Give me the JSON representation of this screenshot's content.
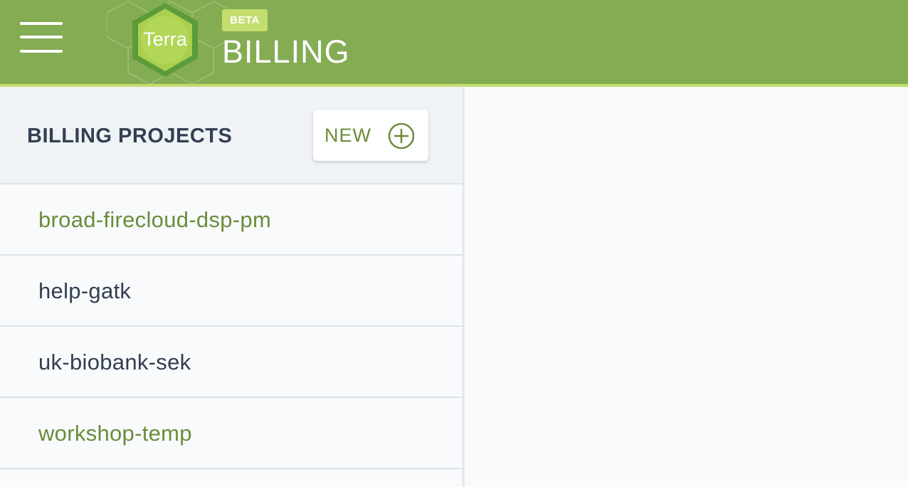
{
  "header": {
    "logo_text": "Terra",
    "beta_badge": "BETA",
    "title": "BILLING",
    "colors": {
      "bar": "#84ac53",
      "accent": "#c3de6f"
    }
  },
  "sidebar": {
    "title": "BILLING PROJECTS",
    "new_button_label": "NEW",
    "new_button_icon": "plus-circle-icon",
    "projects": [
      {
        "name": "broad-firecloud-dsp-pm",
        "color": "#6a8d3a"
      },
      {
        "name": "help-gatk",
        "color": "#333f52"
      },
      {
        "name": "uk-biobank-sek",
        "color": "#333f52"
      },
      {
        "name": "workshop-temp",
        "color": "#6a8d3a"
      }
    ]
  }
}
